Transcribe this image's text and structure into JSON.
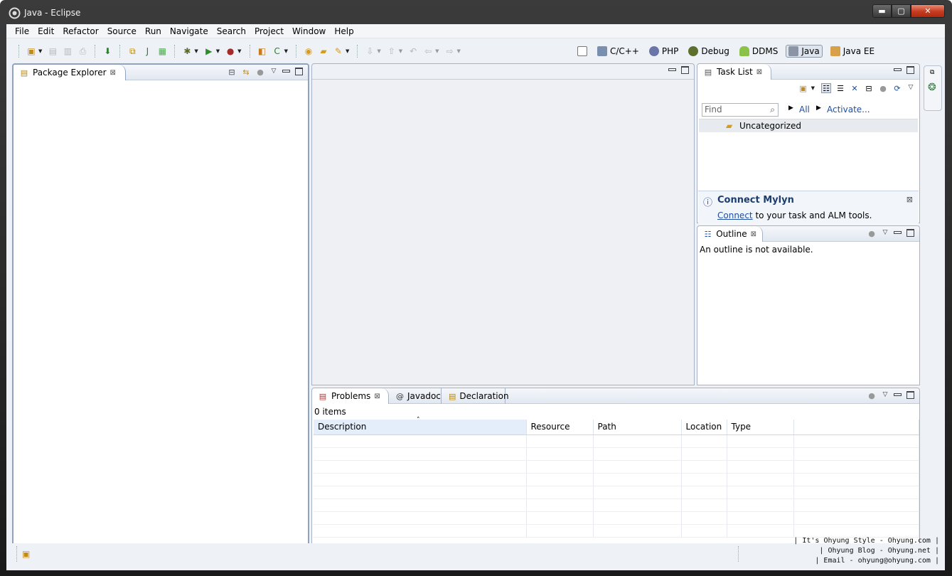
{
  "window": {
    "title": "Java - Eclipse",
    "buttons": {
      "minimize": "▬",
      "maximize": "▢",
      "close": "✕"
    }
  },
  "menu": [
    "File",
    "Edit",
    "Refactor",
    "Source",
    "Run",
    "Navigate",
    "Search",
    "Project",
    "Window",
    "Help"
  ],
  "perspectives": [
    {
      "label": "",
      "icon": "open-perspective-icon"
    },
    {
      "label": "C/C++",
      "icon": "cpp-perspective-icon"
    },
    {
      "label": "PHP",
      "icon": "php-perspective-icon"
    },
    {
      "label": "Debug",
      "icon": "debug-perspective-icon"
    },
    {
      "label": "DDMS",
      "icon": "android-icon"
    },
    {
      "label": "Java",
      "icon": "java-perspective-icon",
      "active": true
    },
    {
      "label": "Java EE",
      "icon": "javaee-perspective-icon"
    }
  ],
  "package_explorer": {
    "tab": "Package Explorer"
  },
  "task_list": {
    "tab": "Task List",
    "find_placeholder": "Find",
    "all_link": "All",
    "activate_link": "Activate...",
    "category": "Uncategorized",
    "mylyn": {
      "title": "Connect Mylyn",
      "link": "Connect",
      "text": " to your task and ALM tools."
    }
  },
  "outline": {
    "tab": "Outline",
    "message": "An outline is not available."
  },
  "bottom": {
    "tabs": [
      "Problems",
      "Javadoc",
      "Declaration"
    ],
    "count": "0 items",
    "columns": [
      "Description",
      "Resource",
      "Path",
      "Location",
      "Type"
    ]
  },
  "watermark": [
    "| It's Ohyung Style - Ohyung.com |",
    "| Ohyung Blog - Ohyung.net |",
    "| Email - ohyung@ohyung.com |"
  ],
  "colors": {
    "accent": "#1f4fa3",
    "chrome": "#eef1f6",
    "border": "#a7b3c4"
  }
}
